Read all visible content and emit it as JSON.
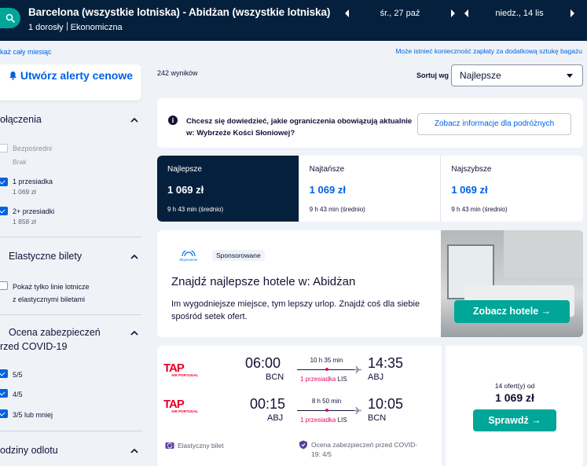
{
  "header": {
    "route": "Barcelona (wszystkie lotniska) - Abidżan (wszystkie lotniska)",
    "passengers": "1 dorosły",
    "cabin": "Ekonomiczna",
    "depart_date": "śr., 27 paź",
    "return_date": "niedz., 14 lis"
  },
  "links": {
    "whole_month": "każ cały miesiąc",
    "baggage_notice": "Może istnieć konieczność zapłaty za dodatkową sztukę bagażu"
  },
  "sidebar": {
    "alert_button": "Utwórz alerty cenowe",
    "stops": {
      "title": "ołączenia",
      "options": [
        {
          "label": "Bezpośredni",
          "sub": "Brak",
          "checked": false,
          "disabled": true
        },
        {
          "label": "1 przesiadka",
          "sub": "1 069 zł",
          "checked": true,
          "disabled": false
        },
        {
          "label": "2+ przesiadki",
          "sub": "1 858 zł",
          "checked": true,
          "disabled": false
        }
      ]
    },
    "flexible": {
      "title": "Elastyczne bilety",
      "option_line1": "Pokaż tylko linie lotnicze",
      "option_line2": "z elastycznymi biletami"
    },
    "covid": {
      "title_line1": "Ocena zabezpieczeń",
      "title_line2": "rzed COVID-19",
      "options": [
        "5/5",
        "4/5",
        "3/5 lub mniej"
      ]
    },
    "times_title": "odziny odlotu"
  },
  "results": {
    "count": "242 wyników",
    "sort_label": "Sortuj wg",
    "sort_value": "Najlepsze"
  },
  "info": {
    "text": "Chcesz się dowiedzieć, jakie ograniczenia obowiązują aktualnie w: Wybrzeże Kości Słoniowej?",
    "button": "Zobacz informacje dla podróżnych"
  },
  "sort_tabs": [
    {
      "title": "Najlepsze",
      "price": "1 069 zł",
      "duration": "9 h 43 min (średnio)"
    },
    {
      "title": "Najtańsze",
      "price": "1 069 zł",
      "duration": "9 h 43 min (średnio)"
    },
    {
      "title": "Najszybsze",
      "price": "1 069 zł",
      "duration": "9 h 43 min (średnio)"
    }
  ],
  "hotel_ad": {
    "logo_text": "Skyscanner",
    "sponsored": "Sponsorowane",
    "title": "Znajdź najlepsze hotele w: Abidżan",
    "description": "Im wygodniejsze miejsce, tym lepszy urlop. Znajdź coś dla siebie spośród setek ofert.",
    "button": "Zobacz hotele →"
  },
  "flight": {
    "airline_logo_text": "TAP",
    "airline_logo_sub": "AIR PORTUGAL",
    "outbound": {
      "dep_time": "06:00",
      "dep_code": "BCN",
      "duration": "10 h 35 min",
      "stops": "1 przesiadka",
      "via": "LIS",
      "arr_time": "14:35",
      "arr_code": "ABJ"
    },
    "inbound": {
      "dep_time": "00:15",
      "dep_code": "ABJ",
      "duration": "8 h 50 min",
      "stops": "1 przesiadka",
      "via": "LIS",
      "arr_time": "10:05",
      "arr_code": "BCN"
    },
    "offers": "14 ofert(y) od",
    "price": "1 069 zł",
    "button": "Sprawdź →",
    "feature_flex": "Elastyczny bilet",
    "feature_covid_line1": "Ocena zabezpieczeń przed COVID-",
    "feature_covid_line2": "19: 4/5"
  },
  "colors": {
    "header_bg": "#05203c",
    "accent": "#00a698",
    "link": "#0062e3",
    "stop": "#e70866"
  }
}
